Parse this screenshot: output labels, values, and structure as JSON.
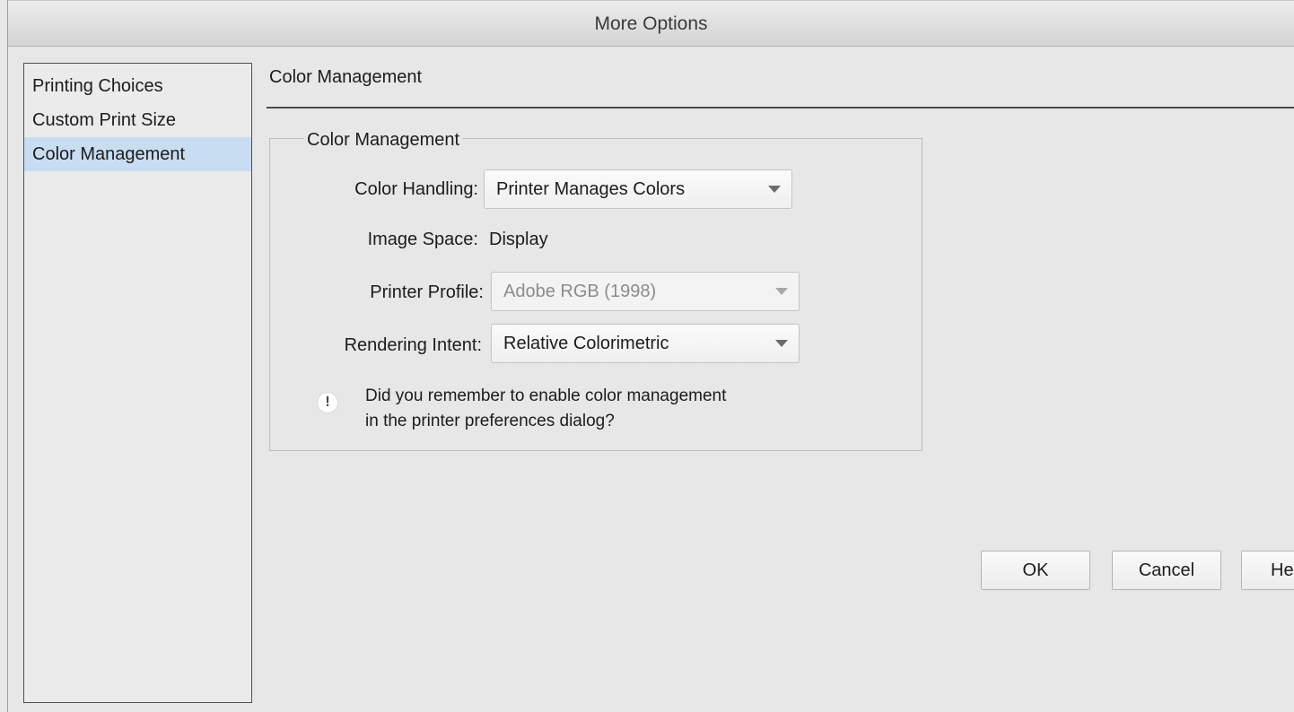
{
  "window": {
    "title": "More Options"
  },
  "sidebar": {
    "items": [
      {
        "label": "Printing Choices",
        "selected": false
      },
      {
        "label": "Custom Print Size",
        "selected": false
      },
      {
        "label": "Color Management",
        "selected": true
      }
    ]
  },
  "main": {
    "section_title": "Color Management",
    "group": {
      "legend": "Color Management",
      "color_handling": {
        "label": "Color Handling:",
        "value": "Printer Manages Colors"
      },
      "image_space": {
        "label": "Image Space:",
        "value": "Display"
      },
      "printer_profile": {
        "label": "Printer Profile:",
        "value": "Adobe RGB (1998)",
        "disabled": true
      },
      "rendering_intent": {
        "label": "Rendering Intent:",
        "value": "Relative Colorimetric"
      },
      "note": {
        "icon": "exclamation-info-icon",
        "line1": "Did you remember to enable color management",
        "line2": "in the printer preferences dialog?"
      }
    }
  },
  "buttons": {
    "ok": "OK",
    "cancel": "Cancel",
    "help": "He"
  },
  "colors": {
    "selection": "#c8dcf2",
    "background": "#e7e7e7"
  }
}
